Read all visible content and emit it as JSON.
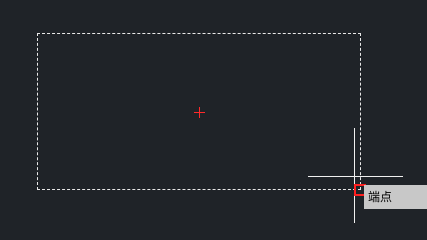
{
  "canvas": {
    "background": "#1f2328"
  },
  "selection": {
    "style": "dashed",
    "color": "#e8e8e8"
  },
  "center_marker": {
    "icon": "red-cross-marker",
    "color": "#ff2a2a"
  },
  "cursor": {
    "icon": "crosshair-cursor",
    "color": "#f0f0f0"
  },
  "osnap": {
    "icon": "endpoint-snap-square",
    "color": "#ff2020",
    "tooltip_label": "端点",
    "tooltip_bg": "#c8c8c8"
  }
}
